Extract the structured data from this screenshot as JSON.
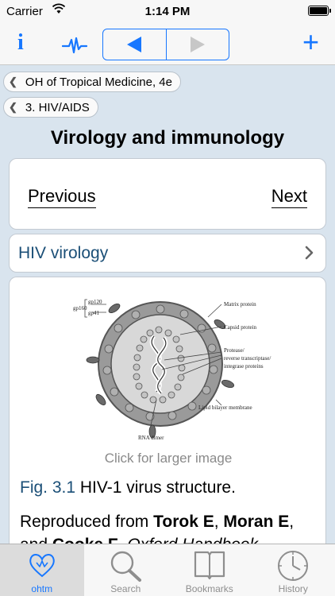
{
  "status_bar": {
    "carrier": "Carrier",
    "time": "1:14 PM",
    "battery_level": 1.0
  },
  "toolbar": {
    "info_icon": "info-icon",
    "pulse_icon": "pulse-icon",
    "back_icon": "back-arrow-icon",
    "forward_icon": "forward-arrow-icon",
    "forward_enabled": false,
    "add_icon": "plus-icon",
    "accent_color": "#1777ff"
  },
  "breadcrumbs": [
    {
      "label": "OH of Tropical Medicine, 4e"
    },
    {
      "label": "3. HIV/AIDS"
    }
  ],
  "page": {
    "title": "Virology and immunology",
    "previous_label": "Previous",
    "next_label": "Next",
    "section_link_label": "HIV virology"
  },
  "figure": {
    "labels": {
      "gp160": "gp160",
      "gp120": "gp120",
      "gp41": "gp41",
      "matrix": "Matrix protein",
      "capsid": "Capsid protein",
      "protease_1": "Protease/",
      "protease_2": "reverse transcriptase/",
      "protease_3": "integrase proteins",
      "lipid": "Lipid bilayer membrane",
      "rna": "RNA dimer"
    },
    "click_hint": "Click for larger image",
    "caption_number": "Fig. 3.1",
    "caption_text": "HIV-1 virus structure.",
    "repro_prefix": "Reproduced from ",
    "repro_author1": "Torok E",
    "repro_sep1": ", ",
    "repro_author2": "Moran E",
    "repro_sep2": ", and ",
    "repro_author3": "Cooke F",
    "repro_sep3": ". ",
    "repro_book": "Oxford Handbook"
  },
  "tabbar": {
    "tabs": [
      {
        "label": "ohtm",
        "icon": "heart-icon",
        "active": true
      },
      {
        "label": "Search",
        "icon": "magnifier-icon",
        "active": false
      },
      {
        "label": "Bookmarks",
        "icon": "book-icon",
        "active": false
      },
      {
        "label": "History",
        "icon": "clock-icon",
        "active": false
      }
    ]
  }
}
